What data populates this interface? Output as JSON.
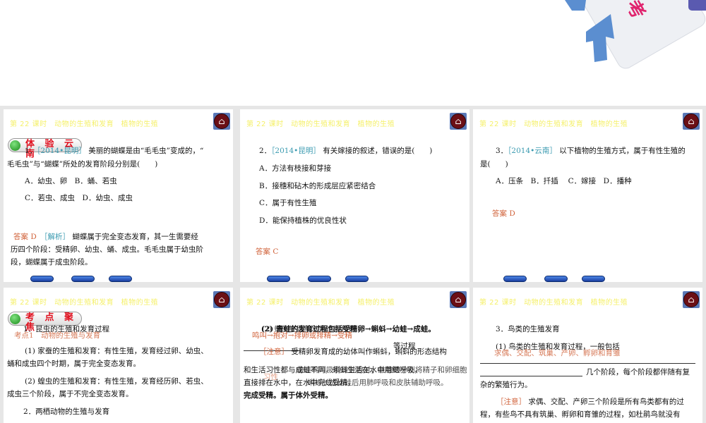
{
  "header_title": "第 22 课时　动物的生殖和发育　植物的生殖",
  "banner_text": "考",
  "slides": [
    {
      "badge": "体 验 云 南",
      "q": "1．",
      "src": "［2014•昆明］",
      "l1": "美丽的蝴蝶是由“毛毛虫”变成的，“",
      "l2": "毛毛虫”与“蝴蝶”所处的发育阶段分别是(　　)",
      "optA": "A．幼虫、卵　B．蛹、若虫",
      "optC": "C．若虫、成虫　D．幼虫、成虫",
      "ans": "答案 D",
      "analysis_tag": "［解析］",
      "a1": "蝴蝶属于完全变态发育，其一生需要经",
      "a2": "历四个阶段：受精卵、幼虫、蛹、成虫。毛毛虫属于幼虫阶",
      "a3": "段，蝴蝶属于成虫阶段。"
    },
    {
      "q": "2．",
      "src": "［2014•昆明］",
      "l1": "有关嫁接的叙述，错误的是(　　)",
      "opts": [
        "A．方法有枝接和芽接",
        "B．接穗和砧木的形成层应紧密结合",
        "C．属于有性生殖",
        "D．能保持植株的优良性状"
      ],
      "ans": "答案 C"
    },
    {
      "q": "3．",
      "src": "［2014•云南］",
      "l1": "以下植物的生殖方式，属于有性生殖的",
      "l2": "是(　　)",
      "opts": "A．压条　B．扦插　 C．嫁接　D．播种",
      "ans": "答案 D"
    },
    {
      "badge": "考 点 聚 焦",
      "h1": "1．昆虫的生殖和发育过程",
      "point": "考点1　动物的生殖与发育",
      "p1a": "(1) 家蚕的生殖和发育：有性生殖，发育经过卵、幼虫、",
      "p1b": "蛹和成虫四个时期，属于完全变态发育。",
      "p2a": "(2) 蝗虫的生殖和发育：有性生殖，发育经历卵、若虫、",
      "p2b": "成虫三个阶段，属于不完全变态发育。",
      "h2": "2．两栖动物的生殖与发育"
    },
    {
      "l1a": "(2) 青蛙的发育过程包括受精卵→蝌蚪→幼蛙→成蛙。",
      "l1b": "(2) 蛙的生殖和发育过程包括",
      "red1": "鸣叫→抱对→排卵或排精→受精",
      "etc": "等过程",
      "note": "［注意］",
      "n1": "受精卵发育成的幼体叫作蝌蚪，蝌蚪的形态结构",
      "n2a": "和生活习性都与成蛙不同，蝌蚪生活在水中用鳃呼吸，",
      "n2b": "雄蛙鸣叫吸引雌蛙抱对，雌雄蛙分别将精子和卵细胞",
      "n3a": "直接排在水中，在水中完成受精，",
      "n3b": "蝌蚪长成幼蛙后用肺呼吸和皮肤辅助呼吸。",
      "n4": "完成受精。属于体外受精。",
      "red2": "习性"
    },
    {
      "h": "3．鸟类的生殖发育",
      "p1": "(1) 鸟类的生殖和发育过程，一般包括",
      "red": "求偶、交配、筑巢、产卵、孵卵和育雏",
      "p2": "几个阶段，每个阶段都伴随有复",
      "p3": "杂的繁殖行为。",
      "note": "［注意］",
      "n1": "求偶、交配、产卵三个阶段是所有鸟类都有的过",
      "n2": "程，有些鸟不具有筑巢、孵卵和育雏的过程，如杜鹃鸟就没有"
    }
  ]
}
